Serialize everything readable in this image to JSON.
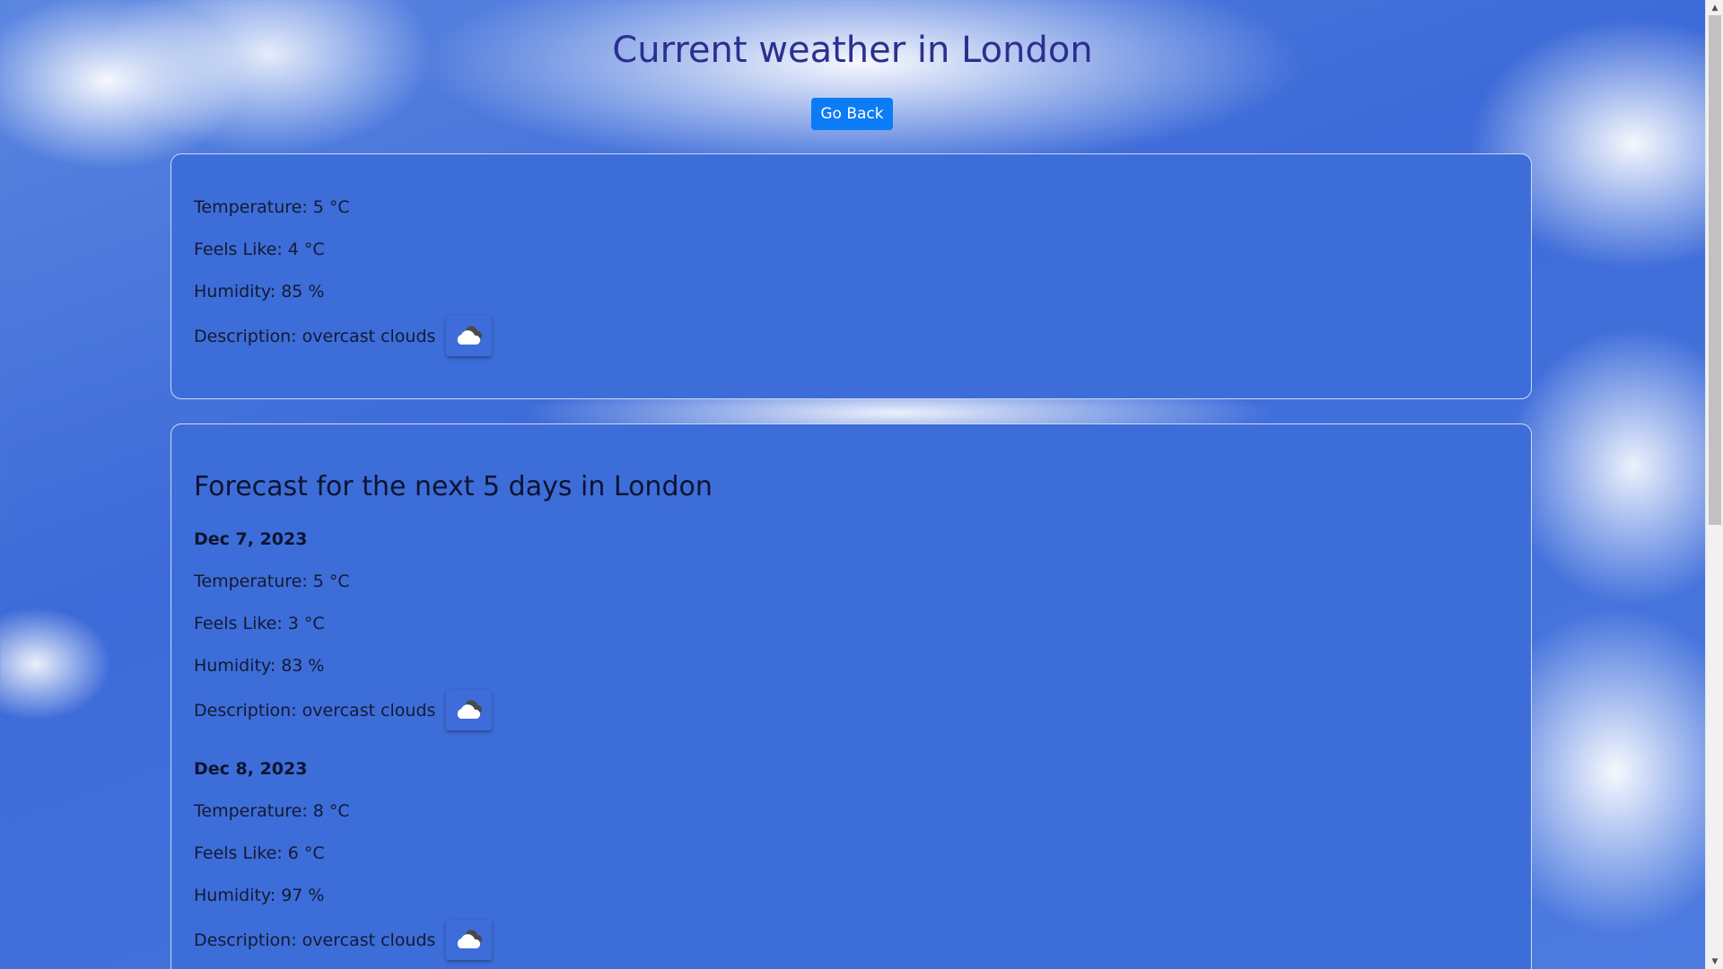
{
  "page": {
    "title": "Current weather in London",
    "go_back_label": "Go Back"
  },
  "current": {
    "temperature": "Temperature: 5 °C",
    "feels_like": "Feels Like: 4 °C",
    "humidity": "Humidity: 85 %",
    "description": "Description: overcast clouds",
    "icon": "cloud-icon"
  },
  "forecast": {
    "title": "Forecast for the next 5 days in London",
    "days": [
      {
        "date": "Dec 7, 2023",
        "temperature": "Temperature: 5 °C",
        "feels_like": "Feels Like: 3 °C",
        "humidity": "Humidity: 83 %",
        "description": "Description: overcast clouds",
        "icon": "cloud-icon"
      },
      {
        "date": "Dec 8, 2023",
        "temperature": "Temperature: 8 °C",
        "feels_like": "Feels Like: 6 °C",
        "humidity": "Humidity: 97 %",
        "description": "Description: overcast clouds",
        "icon": "cloud-icon"
      }
    ]
  },
  "colors": {
    "title": "#2c2f8f",
    "button": "#0b7cf5",
    "card": "#3d6dd8"
  }
}
